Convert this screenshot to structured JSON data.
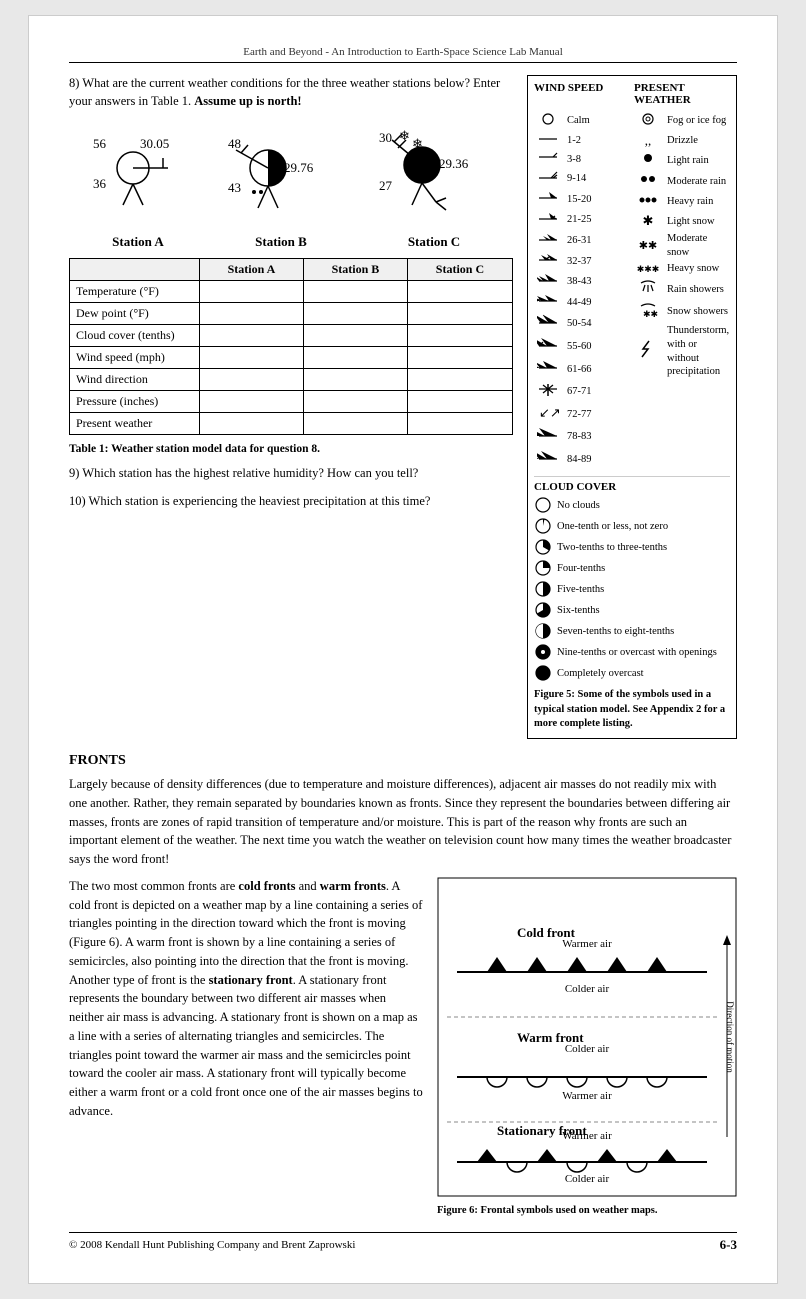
{
  "header": {
    "title": "Earth and Beyond - An Introduction to Earth-Space Science Lab Manual"
  },
  "questions": {
    "q8": {
      "text": "8) What are the current weather conditions for the three weather stations below? Enter your answers in Table 1.",
      "bold": "Assume up is north!"
    },
    "q9": {
      "text": "9) Which station has the highest relative humidity? How can you tell?"
    },
    "q10": {
      "text": "10) Which station is experiencing the heaviest precipitation at this time?"
    }
  },
  "stations": {
    "a": {
      "label": "Station A",
      "temp": "56",
      "dew": "36",
      "pressure": "30.05"
    },
    "b": {
      "label": "Station B",
      "temp": "48",
      "dew": "43",
      "pressure": "29.76"
    },
    "c": {
      "label": "Station C",
      "temp": "30",
      "dew": "27",
      "pressure": "29.36"
    }
  },
  "table": {
    "caption": "Table 1: Weather station model data for question 8.",
    "headers": [
      "",
      "Station A",
      "Station B",
      "Station C"
    ],
    "rows": [
      "Temperature (°F)",
      "Dew point (°F)",
      "Cloud cover (tenths)",
      "Wind speed (mph)",
      "Wind direction",
      "Pressure (inches)",
      "Present weather"
    ]
  },
  "legend": {
    "wind_speed_title": "WIND SPEED",
    "present_weather_title": "PRESENT WEATHER",
    "wind_rows": [
      {
        "symbol": "calm",
        "range": "Calm"
      },
      {
        "symbol": "1-2",
        "range": "1-2"
      },
      {
        "symbol": "3-8",
        "range": "3-8"
      },
      {
        "symbol": "9-14",
        "range": "9-14"
      },
      {
        "symbol": "15-20",
        "range": "15-20"
      },
      {
        "symbol": "21-25",
        "range": "21-25"
      },
      {
        "symbol": "26-31",
        "range": "26-31"
      },
      {
        "symbol": "32-37",
        "range": "32-37"
      },
      {
        "symbol": "38-43",
        "range": "38-43"
      },
      {
        "symbol": "44-49",
        "range": "44-49"
      },
      {
        "symbol": "50-54",
        "range": "50-54"
      },
      {
        "symbol": "55-60",
        "range": "55-60"
      },
      {
        "symbol": "61-66",
        "range": "61-66"
      },
      {
        "symbol": "67-71",
        "range": "67-71"
      },
      {
        "symbol": "72-77",
        "range": "72-77"
      },
      {
        "symbol": "78-83",
        "range": "78-83"
      },
      {
        "symbol": "84-89",
        "range": "84-89"
      }
    ],
    "weather_rows": [
      {
        "symbol": "fog",
        "label": "Fog or ice fog"
      },
      {
        "symbol": "drizzle",
        "label": "Drizzle"
      },
      {
        "symbol": "light_rain",
        "label": "Light rain"
      },
      {
        "symbol": "mod_rain",
        "label": "Moderate rain"
      },
      {
        "symbol": "heavy_rain",
        "label": "Heavy rain"
      },
      {
        "symbol": "light_snow",
        "label": "Light snow"
      },
      {
        "symbol": "mod_snow",
        "label": "Moderate snow"
      },
      {
        "symbol": "heavy_snow",
        "label": "Heavy snow"
      },
      {
        "symbol": "rain_shower",
        "label": "Rain showers"
      },
      {
        "symbol": "snow_shower",
        "label": "Snow showers"
      },
      {
        "symbol": "thunderstorm",
        "label": "Thunderstorm, with or without precipitation"
      }
    ],
    "cloud_cover_title": "CLOUD COVER",
    "cloud_rows": [
      {
        "label": "No clouds",
        "fill": 0
      },
      {
        "label": "One-tenth or less, not zero",
        "fill": 0.1
      },
      {
        "label": "Two-tenths to three-tenths",
        "fill": 0.25
      },
      {
        "label": "Four-tenths",
        "fill": 0.4
      },
      {
        "label": "Five-tenths",
        "fill": 0.5
      },
      {
        "label": "Six-tenths",
        "fill": 0.6
      },
      {
        "label": "Seven-tenths to eight-tenths",
        "fill": 0.75
      },
      {
        "label": "Nine-tenths or overcast with openings",
        "fill": 0.9
      },
      {
        "label": "Completely overcast",
        "fill": 1.0
      }
    ],
    "figure_caption": "Figure 5: Some of the symbols used in a typical station model. See Appendix 2 for a more complete listing."
  },
  "fronts": {
    "title": "FRONTS",
    "para1": "Largely because of density differences (due to temperature and moisture differences), adjacent air masses do not readily mix with one another.  Rather, they remain separated by boundaries known as fronts. Since they represent the boundaries between differing air masses, fronts are zones of rapid transition of temperature and/or moisture. This is part of the reason why fronts are such an important element of the weather. The next time you watch the weather on television count how many times the weather broadcaster says the word front!",
    "para2_start": "The two most common fronts are ",
    "bold1": "cold fronts",
    "para2_mid1": " and ",
    "bold2": "warm fronts",
    "para2_mid2": ". A cold front is depicted on a weather map by a line containing a series of triangles pointing in the direction toward which the front is moving (Figure 6). A warm front is shown by a line containing a series of semicircles, also pointing into the direction that the front is moving. Another type of front is the ",
    "bold3": "stationary front",
    "para2_end": ". A stationary front represents the boundary between two different air masses when neither air mass is advancing. A stationary front is shown on a map as a line with a series of alternating triangles and semicircles.  The triangles point toward the warmer air mass and the semicircles point toward the cooler air mass.  A stationary front will typically become either a warm front or a cold front once one of the air masses begins to advance.",
    "diagram_labels": {
      "cold_front": "Cold front",
      "warm_front": "Warm front",
      "stationary_front": "Stationary front",
      "warmer_air_1": "Warmer air",
      "colder_air_1": "Colder air",
      "colder_air_2": "Colder air",
      "warmer_air_2": "Warmer air",
      "warmer_air_3": "Warmer air",
      "colder_air_3": "Colder air",
      "direction": "Direction of motion"
    },
    "figure_caption": "Figure 6: Frontal symbols used on weather maps."
  },
  "footer": {
    "copyright": "© 2008 Kendall Hunt Publishing Company and Brent Zaprowski",
    "page": "6-3"
  }
}
